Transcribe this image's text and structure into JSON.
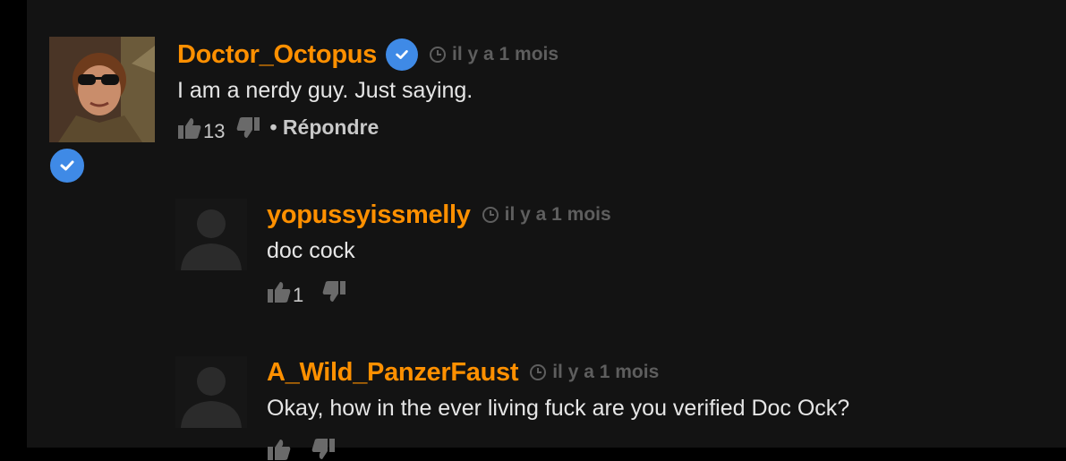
{
  "comments": [
    {
      "username": "Doctor_Octopus",
      "verified": true,
      "time": "il y a 1 mois",
      "text": "I am a nerdy guy. Just saying.",
      "likes": "13",
      "reply_label": "• Répondre"
    },
    {
      "username": "yopussyissmelly",
      "verified": false,
      "time": "il y a 1 mois",
      "text": "doc cock",
      "likes": "1"
    },
    {
      "username": "A_Wild_PanzerFaust",
      "verified": false,
      "time": "il y a 1 mois",
      "text": "Okay, how in the ever living fuck are you verified Doc Ock?",
      "likes": ""
    }
  ],
  "colors": {
    "username": "#ff9000",
    "verified_badge": "#3f8ae6",
    "background": "#131313"
  },
  "icons": [
    "clock-icon",
    "thumbs-up-icon",
    "thumbs-down-icon",
    "verified-check-icon"
  ]
}
